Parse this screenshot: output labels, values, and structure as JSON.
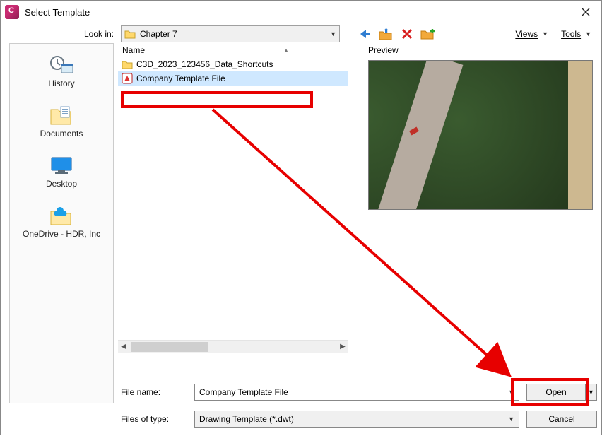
{
  "window": {
    "title": "Select Template"
  },
  "lookin": {
    "label": "Look in:",
    "value": "Chapter 7"
  },
  "menus": {
    "views": "Views",
    "tools": "Tools"
  },
  "places": {
    "history": "History",
    "documents": "Documents",
    "desktop": "Desktop",
    "onedrive": "OneDrive - HDR, Inc"
  },
  "list": {
    "header_name": "Name",
    "rows": [
      {
        "name": "C3D_2023_123456_Data_Shortcuts",
        "kind": "folder"
      },
      {
        "name": "Company Template File",
        "kind": "dwt"
      }
    ]
  },
  "preview": {
    "label": "Preview"
  },
  "form": {
    "filename_label": "File name:",
    "filename_value": "Company Template File",
    "filetype_label": "Files of type:",
    "filetype_value": "Drawing Template (*.dwt)",
    "open": "Open",
    "cancel": "Cancel"
  }
}
